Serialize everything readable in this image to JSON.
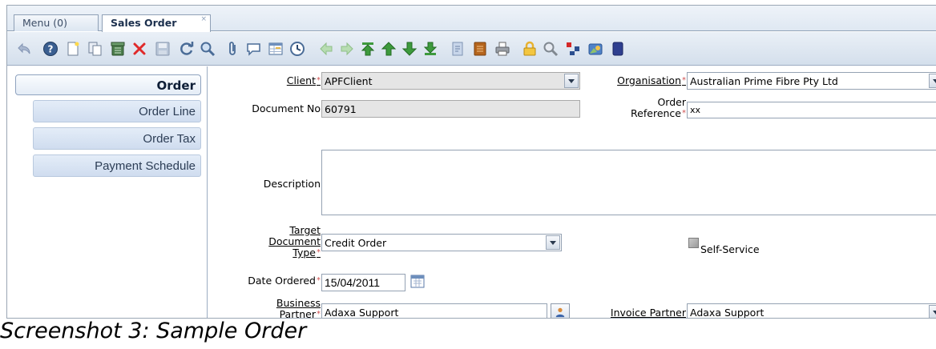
{
  "tabs": {
    "menu": "Menu (0)",
    "active": "Sales Order",
    "close_glyph": "×"
  },
  "toolbar": {
    "icons": [
      "undo-icon",
      "help-icon",
      "new-record-icon",
      "copy-record-icon",
      "delete-selection-icon",
      "delete-icon",
      "save-icon",
      "refresh-icon",
      "find-icon",
      "attachment-icon",
      "chat-icon",
      "grid-toggle-icon",
      "history-icon",
      "parent-record-icon",
      "detail-record-icon",
      "first-record-icon",
      "previous-record-icon",
      "next-record-icon",
      "last-record-icon",
      "report-icon",
      "archive-icon",
      "print-icon",
      "lock-icon",
      "zoom-across-icon",
      "workflow-icon",
      "product-info-icon",
      "end-icon"
    ]
  },
  "leftnav": {
    "main": "Order",
    "items": [
      "Order Line",
      "Order Tax",
      "Payment Schedule"
    ]
  },
  "form": {
    "client_label": "Client",
    "client_value": "APFClient",
    "organisation_label": "Organisation",
    "organisation_value": "Australian Prime Fibre Pty Ltd",
    "docno_label": "Document No",
    "docno_value": "60791",
    "orderref_label_1": "Order",
    "orderref_label_2": "Reference",
    "orderref_value": "xx",
    "description_label": "Description",
    "description_value": "",
    "target_label_1": "Target",
    "target_label_2": "Document",
    "target_label_3": "Type",
    "target_value": "Credit Order",
    "selfservice_label": "Self-Service",
    "dateordered_label": "Date Ordered",
    "dateordered_value": "15/04/2011",
    "bp_label_1": "Business",
    "bp_label_2": "Partner",
    "bp_value": "Adaxa Support",
    "invoice_label": "Invoice Partner",
    "invoice_value": "Adaxa Support",
    "required_marker": "*"
  },
  "caption": "Screenshot 3: Sample Order",
  "colors": {
    "accent": "#1b2f4d",
    "required": "#d05050",
    "readonly_bg": "#e5e5e5"
  }
}
